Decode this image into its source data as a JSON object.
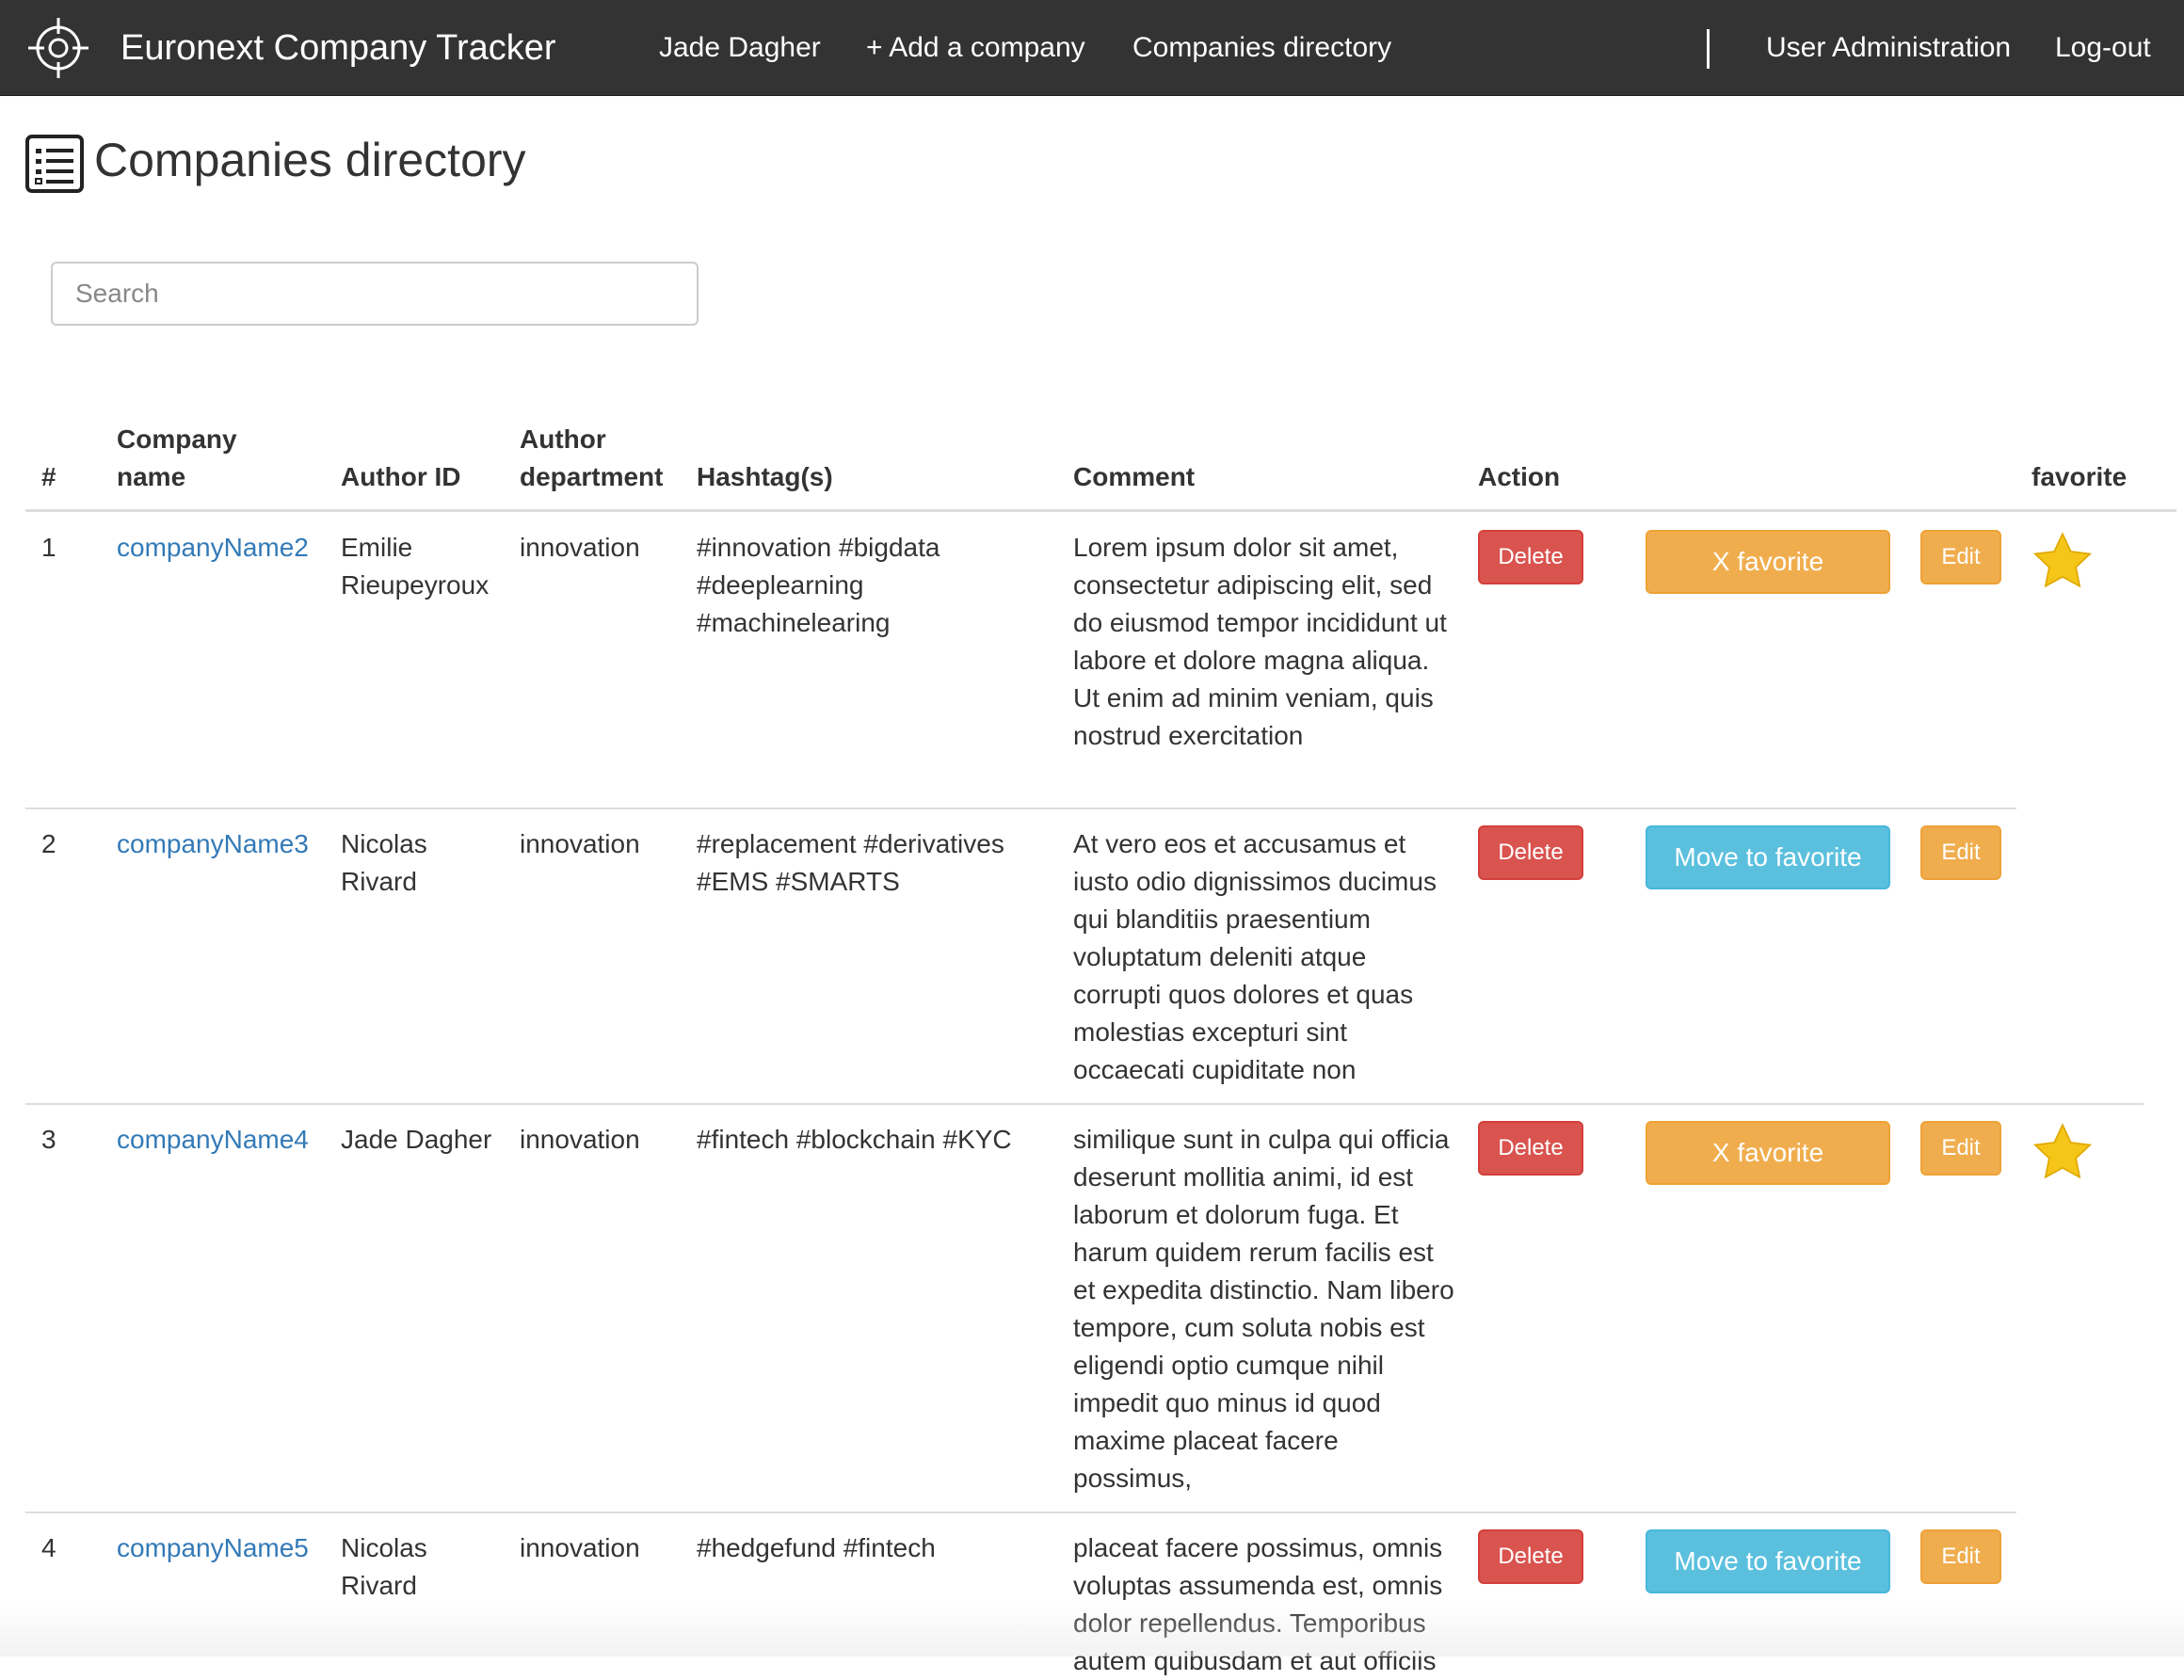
{
  "navbar": {
    "brand": "Euronext Company Tracker",
    "user": "Jade Dagher",
    "add_company": "+ Add a company",
    "directory": "Companies directory",
    "user_admin": "User Administration",
    "logout": "Log-out",
    "icons": {
      "brand": "crosshair-icon"
    }
  },
  "page": {
    "title": "Companies directory",
    "icon": "list-icon"
  },
  "search": {
    "placeholder": "Search"
  },
  "table": {
    "headers": {
      "num": "#",
      "company_l1": "Company",
      "company_l2": "name",
      "author_id": "Author ID",
      "dept_l1": "Author",
      "dept_l2": "department",
      "hashtags": "Hashtag(s)",
      "comment": "Comment",
      "action": "Action",
      "favorite": "favorite"
    },
    "rows": [
      {
        "num": "1",
        "company": "companyName2",
        "author": "Emilie Rieupeyroux",
        "department": "innovation",
        "hashtags": "#innovation #bigdata #deeplearning #machinelearing",
        "comment": "Lorem ipsum dolor sit amet, consectetur adipiscing elit, sed do eiusmod tempor incididunt ut labore et dolore magna aliqua. Ut enim ad minim veniam, quis nostrud exercitation",
        "delete": "Delete",
        "favorite_btn": "X favorite",
        "edit": "Edit",
        "is_favorite": true
      },
      {
        "num": "2",
        "company": "companyName3",
        "author": "Nicolas Rivard",
        "department": "innovation",
        "hashtags": "#replacement #derivatives #EMS #SMARTS",
        "comment": "At vero eos et accusamus et iusto odio dignissimos ducimus qui blanditiis praesentium voluptatum deleniti atque corrupti quos dolores et quas molestias excepturi sint occaecati cupiditate non",
        "delete": "Delete",
        "favorite_btn": "Move to favorite",
        "edit": "Edit",
        "is_favorite": false
      },
      {
        "num": "3",
        "company": "companyName4",
        "author": "Jade Dagher",
        "department": "innovation",
        "hashtags": "#fintech #blockchain #KYC",
        "comment": "similique sunt in culpa qui officia deserunt mollitia animi, id est laborum et dolorum fuga. Et harum quidem rerum facilis est et expedita distinctio. Nam libero tempore, cum soluta nobis est eligendi optio cumque nihil impedit quo minus id quod maxime placeat facere possimus,",
        "delete": "Delete",
        "favorite_btn": "X favorite",
        "edit": "Edit",
        "is_favorite": true
      },
      {
        "num": "4",
        "company": "companyName5",
        "author": "Nicolas Rivard",
        "department": "innovation",
        "hashtags": "#hedgefund #fintech",
        "comment": "placeat facere possimus, omnis voluptas assumenda est, omnis dolor repellendus. Temporibus autem quibusdam et aut officiis",
        "delete": "Delete",
        "favorite_btn": "Move to favorite",
        "edit": "Edit",
        "is_favorite": false
      }
    ]
  },
  "colors": {
    "navbar": "#333333",
    "link": "#337ab7",
    "danger": "#d9534f",
    "warning": "#f0ad4e",
    "info": "#5bc0de",
    "star": "#f5c518"
  }
}
